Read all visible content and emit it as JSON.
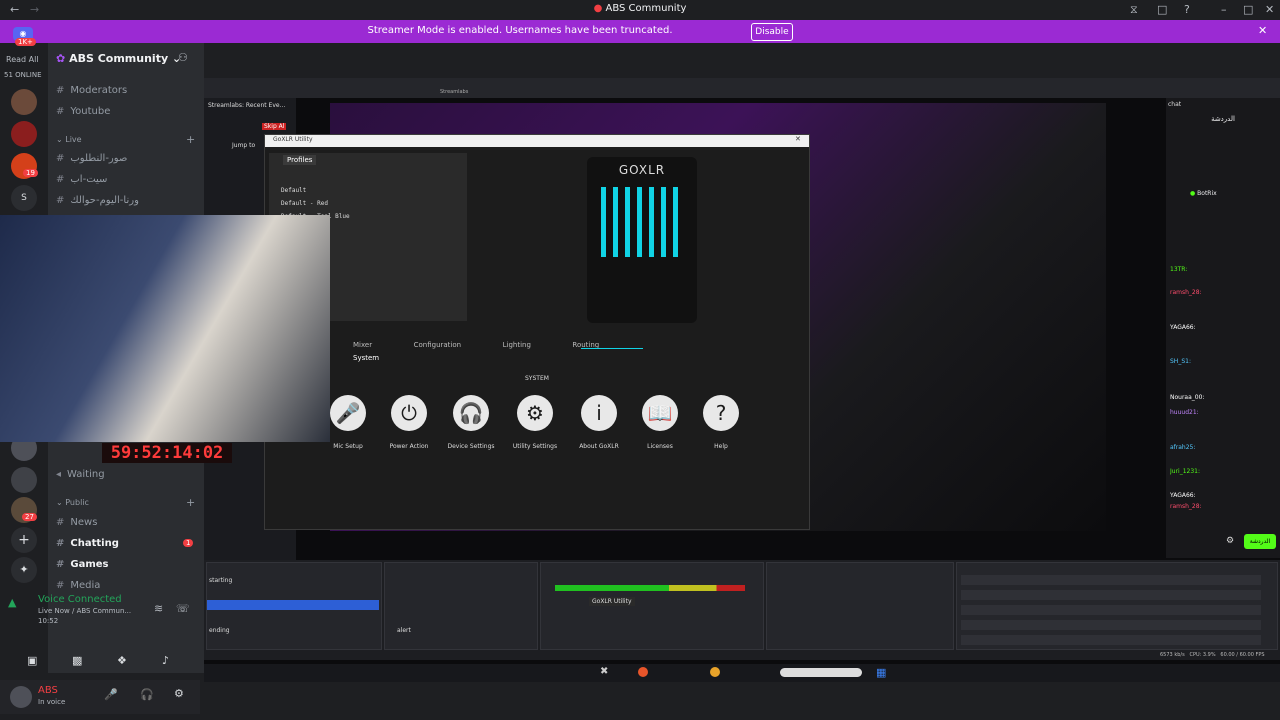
{
  "window": {
    "title": "ABS Community"
  },
  "banner": {
    "message": "Streamer Mode is enabled. Usernames have been truncated.",
    "button": "Disable"
  },
  "rail": {
    "read_all": "Read All",
    "online": "51 ONLINE",
    "badge1": "1K+",
    "badge_red": "19",
    "badge_27": "27"
  },
  "server": {
    "name": "ABS Community"
  },
  "channels": {
    "moderators": "Moderators",
    "youtube": "Youtube",
    "live_category": "Live",
    "live1": "صور-النطلوب",
    "live2": "سيت-اب",
    "live3": "ورنا-اليوم-حوالك",
    "waiting": "Waiting",
    "public_category": "Public",
    "news": "News",
    "chatting": "Chatting",
    "chatting_badge": "1",
    "games": "Games",
    "media": "Media"
  },
  "voice": {
    "status": "Voice Connected",
    "detail": "Live Now / ABS Commun...",
    "time": "10:52"
  },
  "user": {
    "name": "ABS",
    "status": "In voice"
  },
  "timer": "59:52:14:02",
  "obs": {
    "streamlabs_title": "Streamlabs: Recent Eve...",
    "menu_item": "Streamlabs",
    "skip_label": "Skip Al",
    "jump_label": "Jump to"
  },
  "goxlr": {
    "window_title": "GoXLR Utility",
    "profiles_header": "Profiles",
    "profiles": [
      "Default",
      "Default - Red",
      "Default - Teal Blue"
    ],
    "logo": "GOXLR",
    "tabs": [
      "Mixer",
      "Configuration",
      "Lighting",
      "Routing",
      "System"
    ],
    "system_heading": "SYSTEM",
    "system_items": [
      {
        "icon": "microphone-icon",
        "label": "Mic Setup"
      },
      {
        "icon": "power-icon",
        "label": "Power Action"
      },
      {
        "icon": "headphones-icon",
        "label": "Device Settings"
      },
      {
        "icon": "gear-icon",
        "label": "Utility Settings"
      },
      {
        "icon": "info-icon",
        "label": "About GoXLR"
      },
      {
        "icon": "book-icon",
        "label": "Licenses"
      },
      {
        "icon": "help-icon",
        "label": "Help"
      }
    ]
  },
  "chat": {
    "title": "chat",
    "header": "الدردشة",
    "send_button": "الدردشة",
    "pinned_user": "BotRix",
    "lines": [
      "13TR:",
      "ramsh_28:",
      "YAGA66:",
      "SH_S1:",
      "Nouraa_00:",
      "huuud21:",
      "afrah25:",
      "Juri_1231:",
      "YAGA66:",
      "ramsh_28:"
    ]
  },
  "scenes": [
    "starting",
    "",
    "",
    "",
    "ending"
  ],
  "sources": [
    "",
    "",
    "",
    "",
    "alert"
  ],
  "mixer": {
    "device": "GoXLR Utility"
  },
  "stats": {
    "cpu": "CPU: 3.9%",
    "fps": "60.00 / 60.00 FPS",
    "bitrate": "6573 kb/s"
  }
}
